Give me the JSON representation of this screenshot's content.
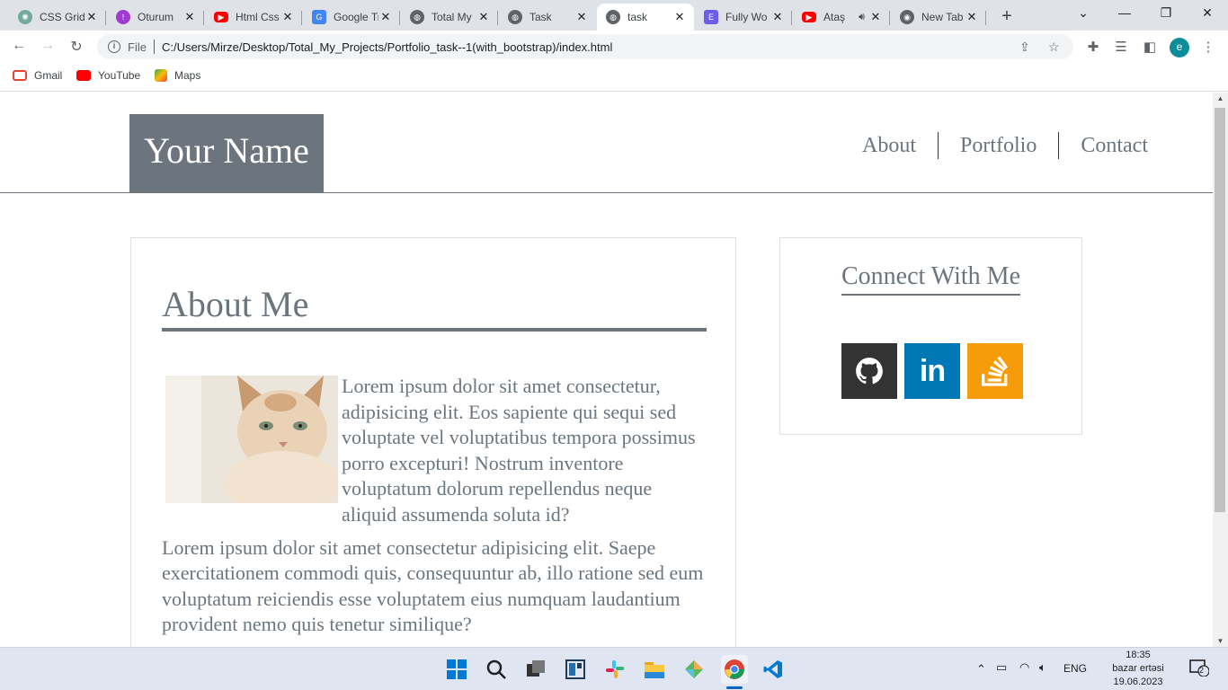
{
  "browser": {
    "tabs": [
      {
        "title": "CSS Grid",
        "icon": "chatgpt-icon",
        "color": "#74aa9c"
      },
      {
        "title": "Oturum",
        "icon": "oturum-icon",
        "color": "#a13ad1"
      },
      {
        "title": "Html Css",
        "icon": "youtube-icon",
        "color": "#ff0000"
      },
      {
        "title": "Google Translate",
        "icon": "google-translate-icon",
        "color": "#4285f4"
      },
      {
        "title": "Total My",
        "icon": "globe-icon",
        "color": "#5f6368"
      },
      {
        "title": "Task",
        "icon": "globe-icon",
        "color": "#5f6368"
      },
      {
        "title": "task",
        "icon": "globe-icon",
        "color": "#5f6368",
        "active": true
      },
      {
        "title": "Fully Wo",
        "icon": "elementor-icon",
        "color": "#6c5ce7"
      },
      {
        "title": "Ataş",
        "icon": "youtube-icon",
        "color": "#ff0000"
      },
      {
        "title": "New Tab",
        "icon": "chrome-icon",
        "color": "#5f6368"
      }
    ],
    "address": {
      "scheme_label": "File",
      "url": "C:/Users/Mirze/Desktop/Total_My_Projects/Portfolio_task--1(with_bootstrap)/index.html"
    },
    "profile_initial": "e",
    "bookmarks": [
      {
        "label": "Gmail",
        "icon": "gmail-icon",
        "color": "#ea4335"
      },
      {
        "label": "YouTube",
        "icon": "youtube-icon",
        "color": "#ff0000"
      },
      {
        "label": "Maps",
        "icon": "maps-icon",
        "color": "#34a853"
      }
    ]
  },
  "site": {
    "brand": "Your Name",
    "nav": [
      "About",
      "Portfolio",
      "Contact"
    ],
    "about": {
      "heading": "About Me",
      "para1": "Lorem ipsum dolor sit amet consectetur, adipisicing elit. Eos sapiente qui sequi sed voluptate vel voluptatibus tempora possimus porro excepturi! Nostrum inventore voluptatum dolorum repellendus neque aliquid assumenda soluta id?",
      "para2": "Lorem ipsum dolor sit amet consectetur adipisicing elit. Saepe exercitationem commodi quis, consequuntur ab, illo ratione sed eum voluptatum reiciendis esse voluptatem eius numquam laudantium provident nemo quis tenetur similique?"
    },
    "connect": {
      "heading": "Connect With Me",
      "links": [
        {
          "name": "GitHub",
          "icon": "github-icon",
          "color": "#333333"
        },
        {
          "name": "LinkedIn",
          "icon": "linkedin-icon",
          "color": "#0077b5"
        },
        {
          "name": "Stack Overflow",
          "icon": "stackoverflow-icon",
          "color": "#f48024"
        }
      ]
    }
  },
  "taskbar": {
    "language": "ENG",
    "time": "18:35",
    "day": "bazar ertəsi",
    "date": "19.06.2023",
    "notification_count": "2"
  }
}
